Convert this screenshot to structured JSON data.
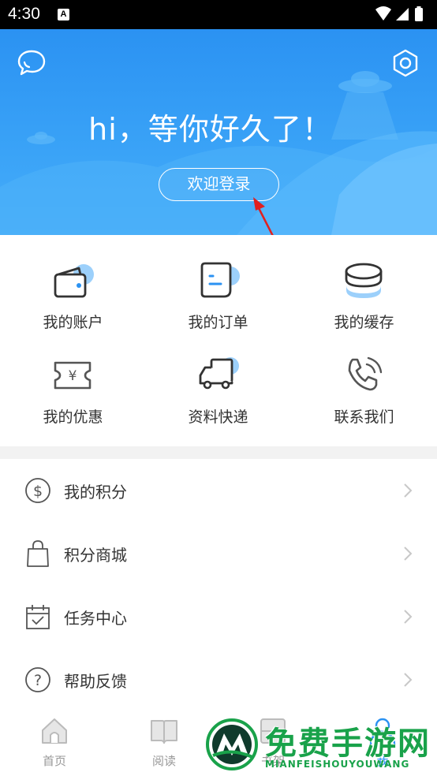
{
  "status_bar": {
    "time": "4:30",
    "notification_letter": "A"
  },
  "header": {
    "greeting": "hi，等你好久了！",
    "login_label": "欢迎登录",
    "chat_icon": "chat-bubble-icon",
    "settings_icon": "hexagon-settings-icon"
  },
  "grid": {
    "items": [
      {
        "label": "我的账户",
        "icon": "wallet-icon"
      },
      {
        "label": "我的订单",
        "icon": "order-icon"
      },
      {
        "label": "我的缓存",
        "icon": "cache-stack-icon"
      },
      {
        "label": "我的优惠",
        "icon": "coupon-icon"
      },
      {
        "label": "资料快递",
        "icon": "delivery-truck-icon"
      },
      {
        "label": "联系我们",
        "icon": "phone-icon"
      }
    ]
  },
  "list": {
    "items": [
      {
        "label": "我的积分",
        "icon": "dollar-coin-icon"
      },
      {
        "label": "积分商城",
        "icon": "shopping-bag-icon"
      },
      {
        "label": "任务中心",
        "icon": "calendar-check-icon"
      },
      {
        "label": "帮助反馈",
        "icon": "question-icon"
      }
    ]
  },
  "bottom_nav": {
    "items": [
      {
        "label": "首页",
        "icon": "home-icon"
      },
      {
        "label": "阅读",
        "icon": "book-icon"
      },
      {
        "label": "书架",
        "icon": "bookshelf-icon"
      },
      {
        "label": "我",
        "icon": "user-icon",
        "active": true
      }
    ]
  },
  "watermark": {
    "title": "免费手游网",
    "subtitle": "MIANFEISHOUYOUWANG"
  },
  "colors": {
    "primary": "#2b92f2",
    "accent_light": "#9cd0fb",
    "annotation": "#e02020",
    "watermark": "#19a24a"
  }
}
